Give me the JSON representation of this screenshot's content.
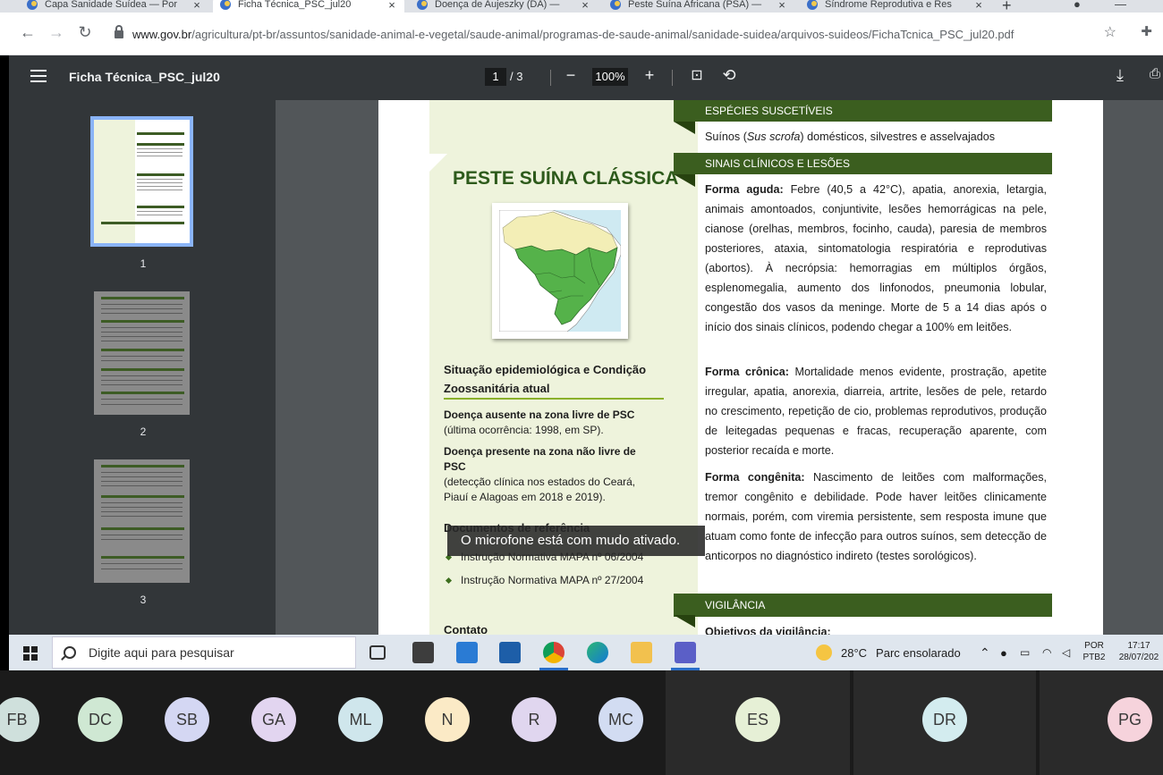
{
  "browser": {
    "tabs": [
      {
        "label": "Capa Sanidade Suídea — Por",
        "active": false
      },
      {
        "label": "Ficha Técnica_PSC_jul20",
        "active": true
      },
      {
        "label": "Doença de Aujeszky (DA) — ",
        "active": false
      },
      {
        "label": "Peste Suína Africana (PSA) — ",
        "active": false
      },
      {
        "label": "Síndrome Reprodutiva e Res",
        "active": false
      }
    ],
    "tab_close": "×",
    "new_tab": "+",
    "url_domain": "www.gov.br",
    "url_path": "/agricultura/pt-br/assuntos/sanidade-animal-e-vegetal/saude-animal/programas-de-saude-animal/sanidade-suidea/arquivos-suideos/FichaTcnica_PSC_jul20.pdf"
  },
  "pdf_toolbar": {
    "title": "Ficha Técnica_PSC_jul20",
    "current_page": "1",
    "total_pages": "/ 3",
    "zoom": "100%"
  },
  "thumbnails": [
    {
      "number": "1"
    },
    {
      "number": "2"
    },
    {
      "number": "3"
    }
  ],
  "document": {
    "title": "PESTE SUÍNA CLÁSSICA",
    "situation_heading": "Situação epidemiológica e Condição Zoossanitária atual",
    "absent_bold": "Doença ausente na zona livre de PSC",
    "absent_text": "(última ocorrência: 1998, em SP).",
    "present_bold": "Doença presente na zona não livre de PSC",
    "present_text": "(detecção clínica nos estados do Ceará, Piauí e Alagoas em 2018 e 2019).",
    "references_heading": "Documentos de referência",
    "references": [
      "Instrução Normativa MAPA nº 06/2004",
      "Instrução Normativa MAPA nº 27/2004"
    ],
    "contact_heading": "Contato",
    "species_header": "ESPÉCIES SUSCETÍVEIS",
    "species_pre": "Suínos (",
    "species_italic": "Sus scrofa",
    "species_post": ") domésticos, silvestres e asselvajados",
    "clinical_header": "SINAIS CLÍNICOS E LESÕES",
    "acute_label": "Forma aguda:",
    "acute_text": " Febre (40,5 a 42°C), apatia, anorexia, letargia, animais amontoados, conjuntivite, lesões hemorrágicas na pele, cianose (orelhas, membros, focinho, cauda), paresia de membros posteriores, ataxia, sintomatologia respiratória e reprodutivas (abortos). À necrópsia: hemorragias em múltiplos órgãos, esplenomegalia, aumento dos linfonodos, pneumonia lobular, congestão dos vasos da meninge. Morte de 5 a 14 dias após o início dos sinais clínicos, podendo chegar a 100% em leitões.",
    "chronic_label": "Forma crônica:",
    "chronic_text": " Mortalidade menos evidente, prostração, apetite irregular, apatia, anorexia, diarreia, artrite, lesões de pele, retardo no crescimento, repetição de cio, problemas reprodutivos, produção de leitegadas pequenas e fracas, recuperação aparente, com posterior recaída e morte.",
    "congenital_label": "Forma congênita:",
    "congenital_text": " Nascimento de leitões com malformações, tremor congênito e debilidade. Pode haver leitões clinicamente normais, porém, com viremia persistente, sem resposta imune que atuam como fonte de infecção para outros suínos, sem detecção de anticorpos no diagnóstico indireto (testes sorológicos).",
    "surveillance_header": "VIGILÂNCIA",
    "surveillance_sub": "Objetivos da vigilância:"
  },
  "toast": {
    "text": "O microfone está com mudo ativado."
  },
  "taskbar": {
    "search_placeholder": "Digite aqui para pesquisar",
    "weather_temp": "28°C",
    "weather_text": "Parc ensolarado",
    "lang_top": "POR",
    "lang_bottom": "PTB2",
    "time": "17:17",
    "date": "28/07/202"
  },
  "participants": [
    {
      "initials": "FB",
      "color": "#cfe0dc"
    },
    {
      "initials": "DC",
      "color": "#cfe8d3"
    },
    {
      "initials": "SB",
      "color": "#d4d7f3"
    },
    {
      "initials": "GA",
      "color": "#e2d5f0"
    },
    {
      "initials": "ML",
      "color": "#cfe6ec"
    },
    {
      "initials": "N",
      "color": "#fbeac6"
    },
    {
      "initials": "R",
      "color": "#e0d6ef"
    },
    {
      "initials": "MC",
      "color": "#d2dcf2"
    },
    {
      "initials": "ES",
      "color": "#e6f0d6"
    },
    {
      "initials": "DR",
      "color": "#d3ecef"
    },
    {
      "initials": "PG",
      "color": "#f6d3dc"
    }
  ]
}
